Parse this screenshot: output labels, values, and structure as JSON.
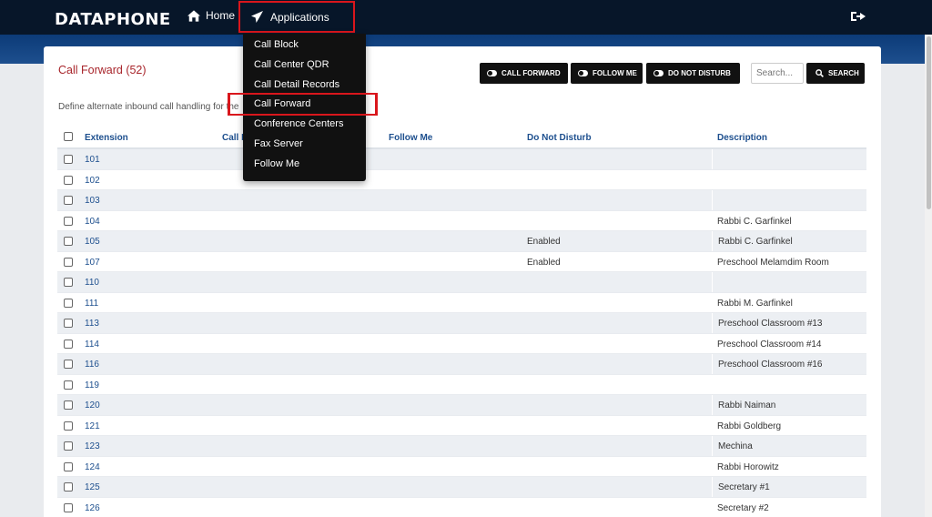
{
  "brand": {
    "logo": "DATAPHONE"
  },
  "nav": {
    "home": "Home",
    "applications": "Applications"
  },
  "menu": [
    "Call Block",
    "Call Center QDR",
    "Call Detail Records",
    "Call Forward",
    "Conference Centers",
    "Fax Server",
    "Follow Me"
  ],
  "page": {
    "title": "Call Forward (52)",
    "description": "Define alternate inbound call handling for the"
  },
  "toolbar": {
    "call_forward": "CALL FORWARD",
    "follow_me": "FOLLOW ME",
    "do_not_disturb": "DO NOT DISTURB",
    "search_placeholder": "Search...",
    "search": "SEARCH"
  },
  "table": {
    "columns": {
      "extension": "Extension",
      "call_forward": "Call Forward",
      "follow_me": "Follow Me",
      "do_not_disturb": "Do Not Disturb",
      "description": "Description"
    },
    "rows": [
      {
        "ext": "101",
        "dnd": "",
        "desc": ""
      },
      {
        "ext": "102",
        "dnd": "",
        "desc": ""
      },
      {
        "ext": "103",
        "dnd": "",
        "desc": ""
      },
      {
        "ext": "104",
        "dnd": "",
        "desc": "Rabbi C. Garfinkel"
      },
      {
        "ext": "105",
        "dnd": "Enabled",
        "desc": "Rabbi C. Garfinkel"
      },
      {
        "ext": "107",
        "dnd": "Enabled",
        "desc": "Preschool Melamdim Room"
      },
      {
        "ext": "110",
        "dnd": "",
        "desc": ""
      },
      {
        "ext": "111",
        "dnd": "",
        "desc": "Rabbi M. Garfinkel"
      },
      {
        "ext": "113",
        "dnd": "",
        "desc": "Preschool Classroom #13"
      },
      {
        "ext": "114",
        "dnd": "",
        "desc": "Preschool Classroom #14"
      },
      {
        "ext": "116",
        "dnd": "",
        "desc": "Preschool Classroom #16"
      },
      {
        "ext": "119",
        "dnd": "",
        "desc": ""
      },
      {
        "ext": "120",
        "dnd": "",
        "desc": "Rabbi Naiman"
      },
      {
        "ext": "121",
        "dnd": "",
        "desc": "Rabbi Goldberg"
      },
      {
        "ext": "123",
        "dnd": "",
        "desc": "Mechina"
      },
      {
        "ext": "124",
        "dnd": "",
        "desc": "Rabbi Horowitz"
      },
      {
        "ext": "125",
        "dnd": "",
        "desc": "Secretary #1"
      },
      {
        "ext": "126",
        "dnd": "",
        "desc": "Secretary #2"
      }
    ]
  },
  "colors": {
    "title_red": "#a8252b",
    "link_blue": "#1d4f8e",
    "highlight_red": "#d9161c",
    "nav_dark": "#071629"
  }
}
